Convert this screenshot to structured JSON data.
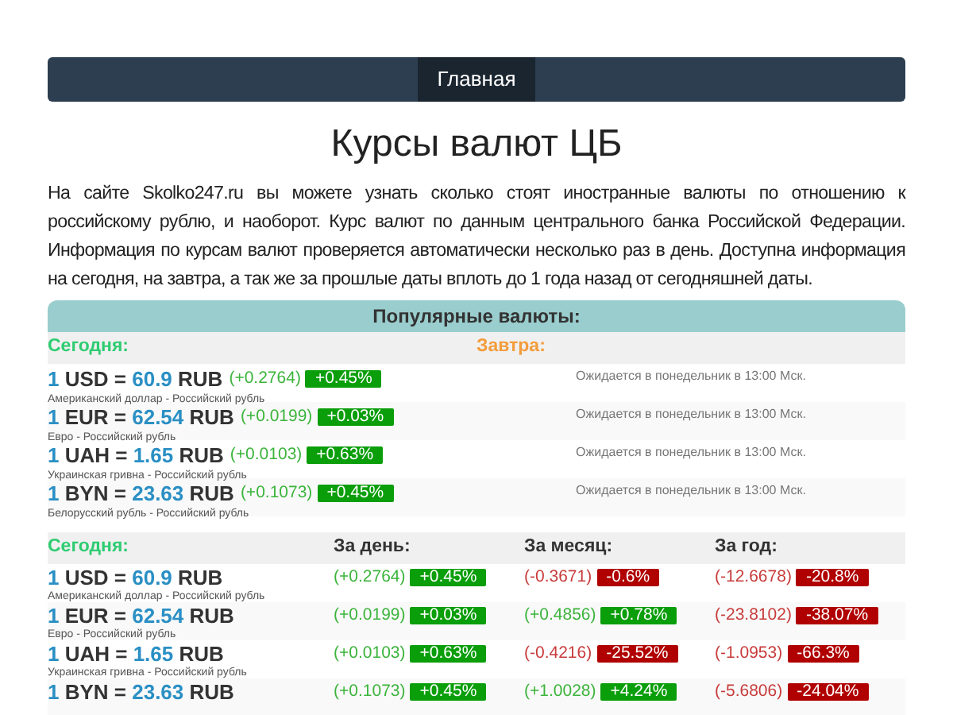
{
  "nav": {
    "items": [
      {
        "label": "Главная",
        "selected": true
      }
    ]
  },
  "title": "Курсы валют ЦБ",
  "intro": "На сайте Skolko247.ru вы можете узнать сколько стоят иностранные валюты по отношению к российскому рублю, и наоборот. Курс валют по данным центрального банка Российской Федерации. Информация по курсам валют проверяется автоматически несколько раз в день. Доступна информация на сегодня, на завтра, а так же за прошлые даты вплоть до 1 года назад от сегодняшней даты.",
  "popular": {
    "title": "Популярные валюты:",
    "today_label": "Сегодня:",
    "tomorrow_label": "Завтра:",
    "rows": [
      {
        "amount": "1",
        "code": "USD",
        "equals": "=",
        "rate": "60.9",
        "target": "RUB",
        "name": "Американский доллар - Российский рубль",
        "change": {
          "kind": "up",
          "abs": "(+0.2764)",
          "pct": "+0.45%"
        },
        "tomorrow": "Ожидается в понедельник в 13:00 Мск."
      },
      {
        "amount": "1",
        "code": "EUR",
        "equals": "=",
        "rate": "62.54",
        "target": "RUB",
        "name": "Евро - Российский рубль",
        "change": {
          "kind": "up",
          "abs": "(+0.0199)",
          "pct": "+0.03%"
        },
        "tomorrow": "Ожидается в понедельник в 13:00 Мск."
      },
      {
        "amount": "1",
        "code": "UAH",
        "equals": "=",
        "rate": "1.65",
        "target": "RUB",
        "name": "Украинская гривна - Российский рубль",
        "change": {
          "kind": "up",
          "abs": "(+0.0103)",
          "pct": "+0.63%"
        },
        "tomorrow": "Ожидается в понедельник в 13:00 Мск."
      },
      {
        "amount": "1",
        "code": "BYN",
        "equals": "=",
        "rate": "23.63",
        "target": "RUB",
        "name": "Белорусский рубль - Российский рубль",
        "change": {
          "kind": "up",
          "abs": "(+0.1073)",
          "pct": "+0.45%"
        },
        "tomorrow": "Ожидается в понедельник в 13:00 Мск."
      }
    ]
  },
  "history": {
    "columns": [
      "Сегодня:",
      "За день:",
      "За месяц:",
      "За год:"
    ],
    "rows": [
      {
        "amount": "1",
        "code": "USD",
        "equals": "=",
        "rate": "60.9",
        "target": "RUB",
        "name": "Американский доллар - Российский рубль",
        "changes": [
          {
            "kind": "up",
            "abs": "(+0.2764)",
            "pct": "+0.45%"
          },
          {
            "kind": "down",
            "abs": "(-0.3671)",
            "pct": "-0.6%"
          },
          {
            "kind": "down",
            "abs": "(-12.6678)",
            "pct": "-20.8%"
          }
        ]
      },
      {
        "amount": "1",
        "code": "EUR",
        "equals": "=",
        "rate": "62.54",
        "target": "RUB",
        "name": "Евро - Российский рубль",
        "changes": [
          {
            "kind": "up",
            "abs": "(+0.0199)",
            "pct": "+0.03%"
          },
          {
            "kind": "up",
            "abs": "(+0.4856)",
            "pct": "+0.78%"
          },
          {
            "kind": "down",
            "abs": "(-23.8102)",
            "pct": "-38.07%"
          }
        ]
      },
      {
        "amount": "1",
        "code": "UAH",
        "equals": "=",
        "rate": "1.65",
        "target": "RUB",
        "name": "Украинская гривна - Российский рубль",
        "changes": [
          {
            "kind": "up",
            "abs": "(+0.0103)",
            "pct": "+0.63%"
          },
          {
            "kind": "down",
            "abs": "(-0.4216)",
            "pct": "-25.52%"
          },
          {
            "kind": "down",
            "abs": "(-1.0953)",
            "pct": "-66.3%"
          }
        ]
      },
      {
        "amount": "1",
        "code": "BYN",
        "equals": "=",
        "rate": "23.63",
        "target": "RUB",
        "changes": [
          {
            "kind": "up",
            "abs": "(+0.1073)",
            "pct": "+0.45%"
          },
          {
            "kind": "up",
            "abs": "(+1.0028)",
            "pct": "+4.24%"
          },
          {
            "kind": "down",
            "abs": "(-5.6806)",
            "pct": "-24.04%"
          }
        ]
      }
    ]
  }
}
